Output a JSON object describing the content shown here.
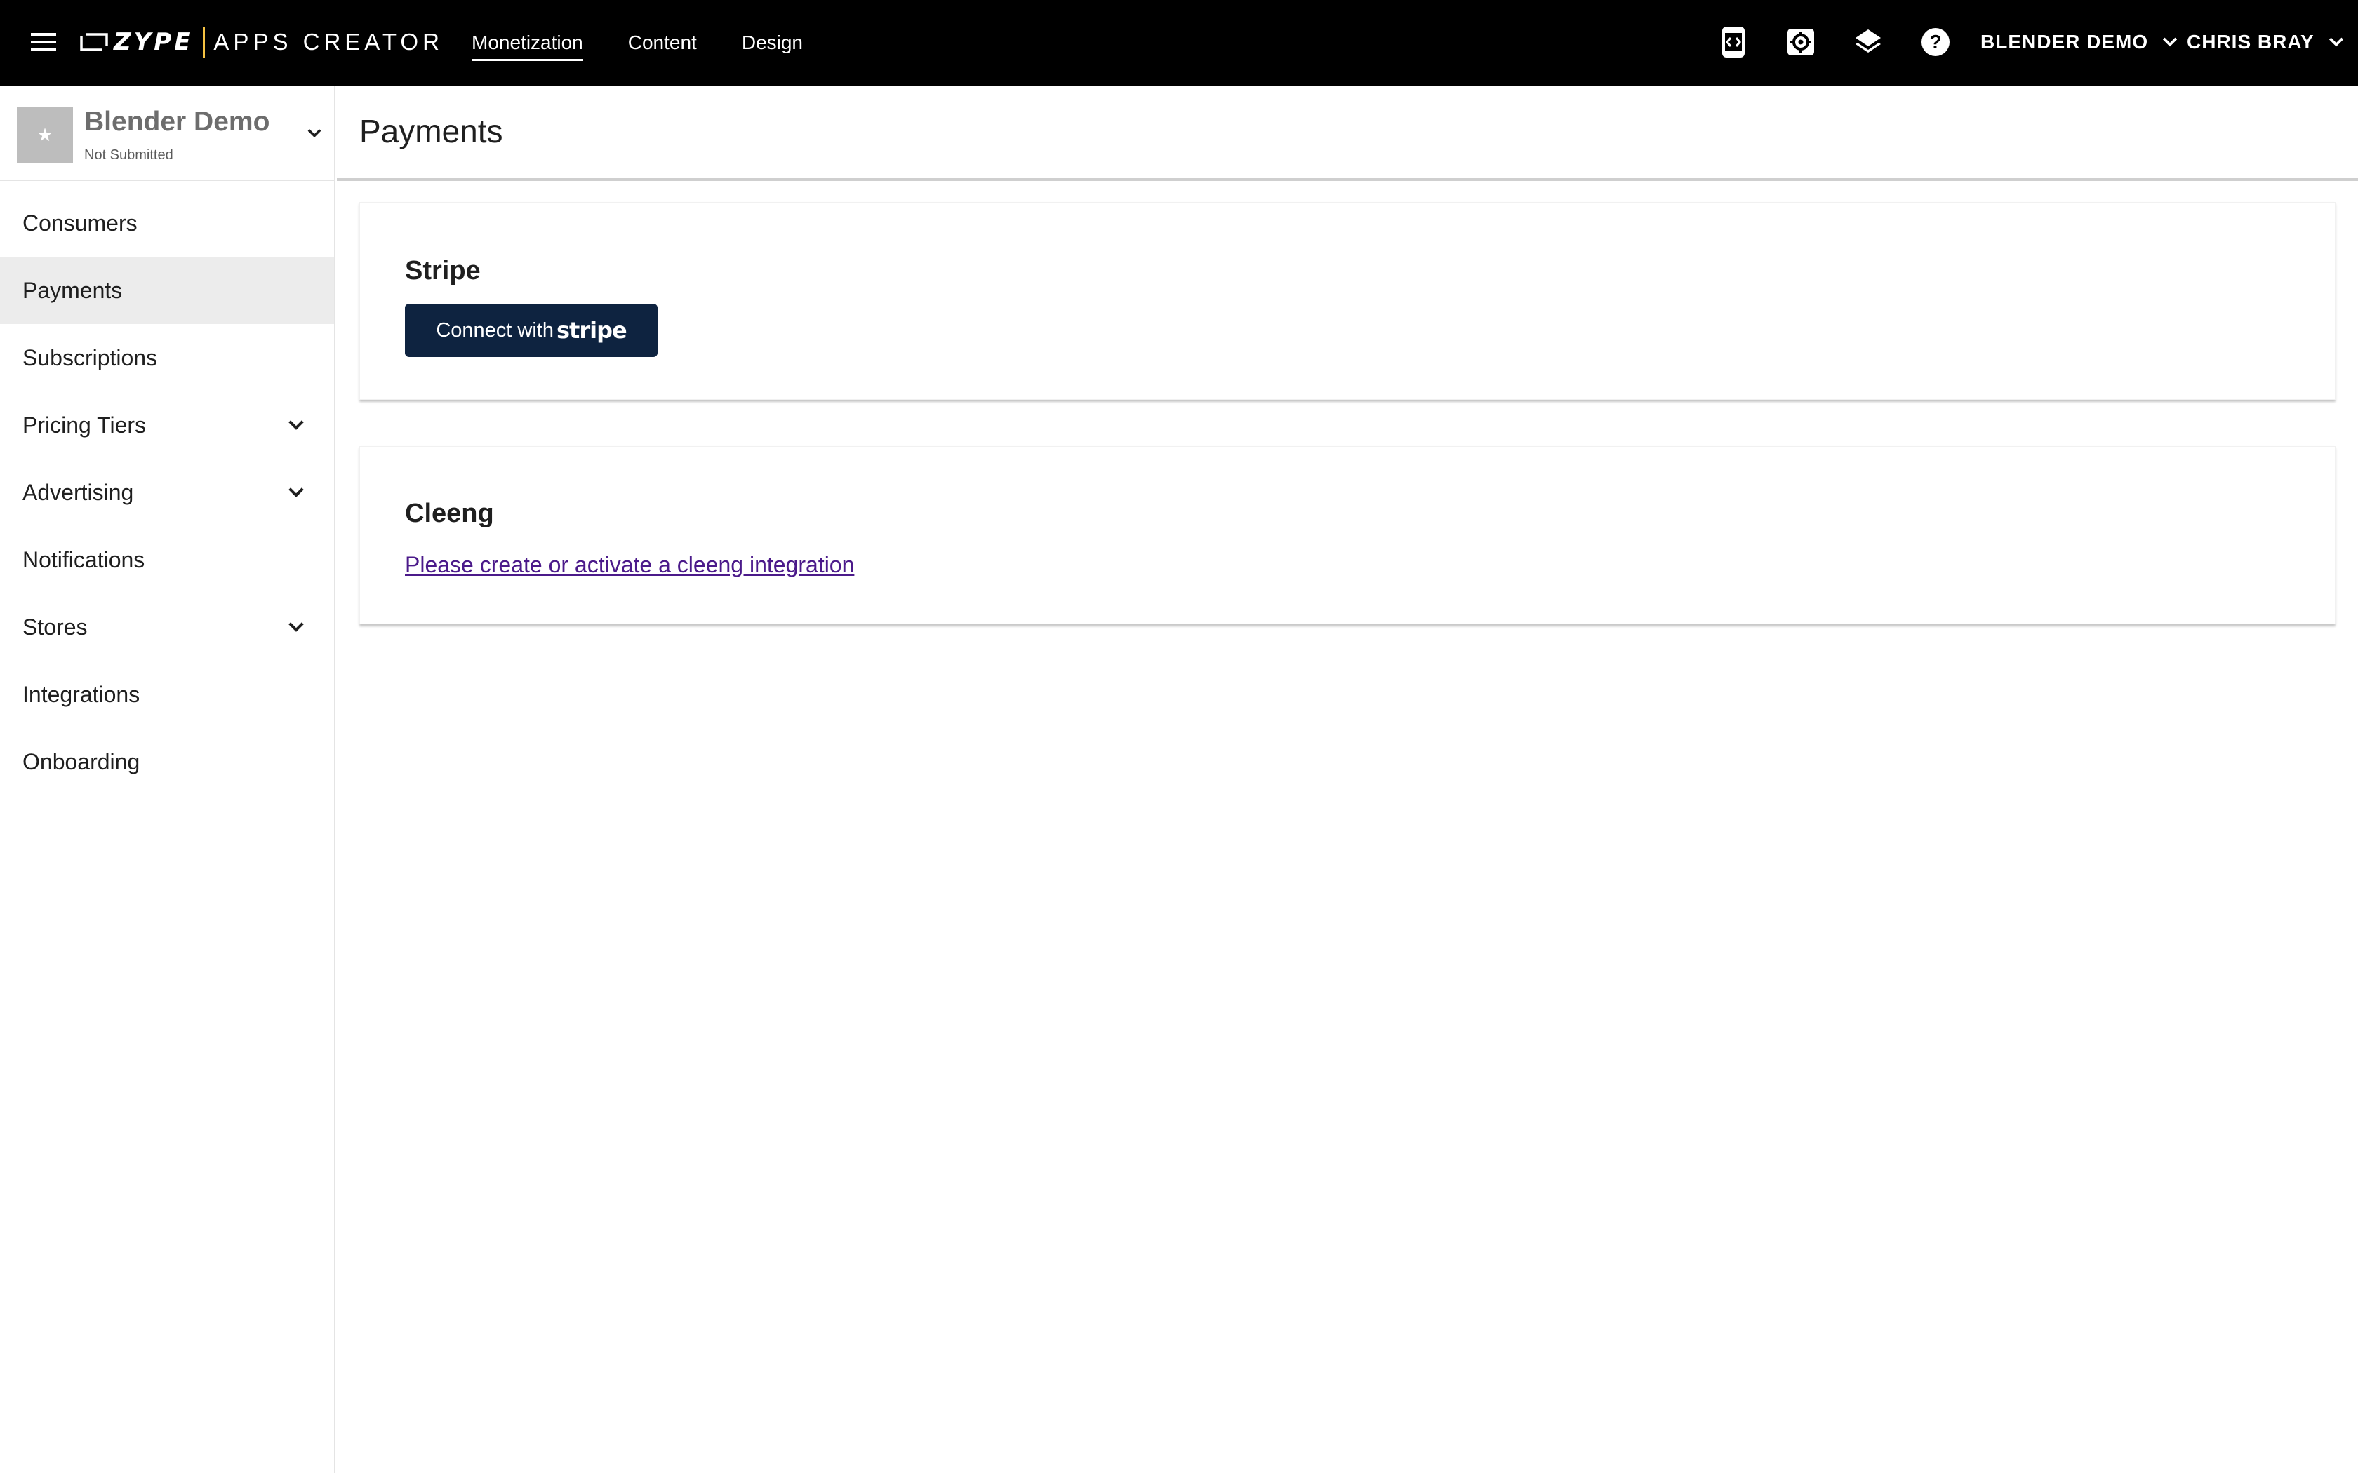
{
  "topbar": {
    "brand": {
      "logo_text": "ZYPE",
      "product_text": "APPS CREATOR"
    },
    "nav": [
      {
        "label": "Monetization",
        "active": true
      },
      {
        "label": "Content",
        "active": false
      },
      {
        "label": "Design",
        "active": false
      }
    ],
    "icons": [
      "app-preview-icon",
      "settings-icon",
      "layers-icon",
      "help-icon"
    ],
    "account_label": "BLENDER DEMO",
    "user_label": "CHRIS BRAY"
  },
  "sidebar": {
    "app": {
      "name": "Blender Demo",
      "status": "Not Submitted"
    },
    "items": [
      {
        "label": "Consumers",
        "expandable": false,
        "active": false
      },
      {
        "label": "Payments",
        "expandable": false,
        "active": true
      },
      {
        "label": "Subscriptions",
        "expandable": false,
        "active": false
      },
      {
        "label": "Pricing Tiers",
        "expandable": true,
        "active": false
      },
      {
        "label": "Advertising",
        "expandable": true,
        "active": false
      },
      {
        "label": "Notifications",
        "expandable": false,
        "active": false
      },
      {
        "label": "Stores",
        "expandable": true,
        "active": false
      },
      {
        "label": "Integrations",
        "expandable": false,
        "active": false
      },
      {
        "label": "Onboarding",
        "expandable": false,
        "active": false
      }
    ]
  },
  "main": {
    "title": "Payments",
    "stripe": {
      "title": "Stripe",
      "button_prefix": "Connect with",
      "button_brand": "stripe"
    },
    "cleeng": {
      "title": "Cleeng",
      "link_text": "Please create or activate a cleeng integration"
    }
  },
  "colors": {
    "topbar_bg": "#000000",
    "brand_accent": "#f5c242",
    "stripe_button_bg": "#0e2340",
    "link_color": "#4b1a8a",
    "active_sidebar_bg": "#ececec"
  }
}
